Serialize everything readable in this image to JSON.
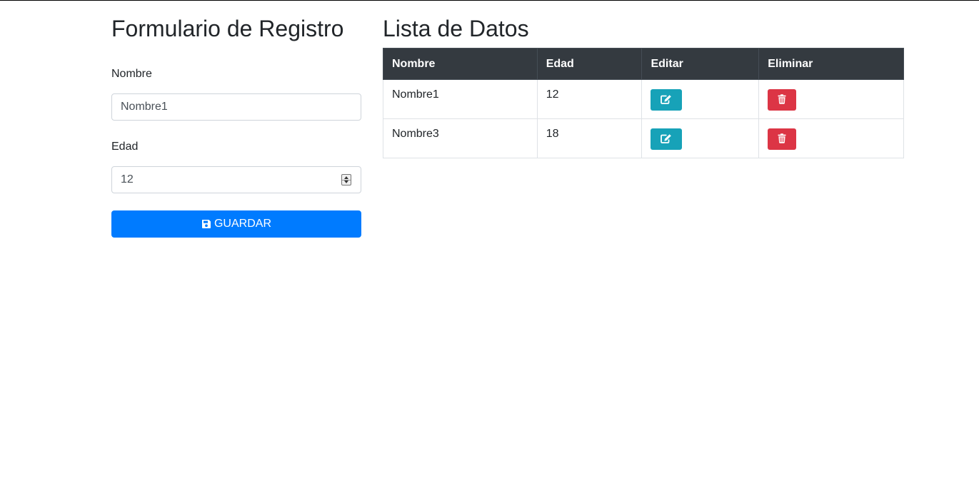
{
  "form": {
    "title": "Formulario de Registro",
    "name_label": "Nombre",
    "name_value": "Nombre1",
    "age_label": "Edad",
    "age_value": "12",
    "save_label": "GUARDAR",
    "save_icon": "save-icon"
  },
  "list": {
    "title": "Lista de Datos",
    "columns": [
      "Nombre",
      "Edad",
      "Editar",
      "Eliminar"
    ],
    "rows": [
      {
        "nombre": "Nombre1",
        "edad": "12"
      },
      {
        "nombre": "Nombre3",
        "edad": "18"
      }
    ],
    "edit_icon": "edit-icon",
    "delete_icon": "trash-icon"
  },
  "colors": {
    "primary": "#007bff",
    "info": "#17a2b8",
    "danger": "#dc3545",
    "table_header": "#343a40"
  }
}
